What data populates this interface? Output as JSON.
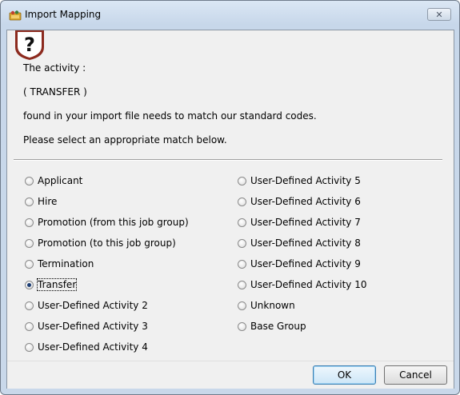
{
  "window": {
    "title": "Import Mapping",
    "close_label": "✕",
    "app_icon": "folder-users-icon"
  },
  "dialog": {
    "icon": "question-icon",
    "message_line1": "The activity :",
    "activity_code": "( TRANSFER )",
    "message_line2": "found in your import file needs to match our standard codes.",
    "message_line3": "Please select an appropriate match below."
  },
  "options": {
    "left": [
      {
        "label": "Applicant",
        "checked": false
      },
      {
        "label": "Hire",
        "checked": false
      },
      {
        "label": "Promotion (from this job group)",
        "checked": false
      },
      {
        "label": "Promotion (to this job group)",
        "checked": false
      },
      {
        "label": "Termination",
        "checked": false
      },
      {
        "label": "Transfer",
        "checked": true
      },
      {
        "label": "User-Defined Activity 2",
        "checked": false
      },
      {
        "label": "User-Defined Activity 3",
        "checked": false
      },
      {
        "label": "User-Defined Activity 4",
        "checked": false
      }
    ],
    "right": [
      {
        "label": "User-Defined Activity 5",
        "checked": false
      },
      {
        "label": "User-Defined Activity 6",
        "checked": false
      },
      {
        "label": "User-Defined Activity 7",
        "checked": false
      },
      {
        "label": "User-Defined Activity 8",
        "checked": false
      },
      {
        "label": "User-Defined Activity 9",
        "checked": false
      },
      {
        "label": "User-Defined Activity 10",
        "checked": false
      },
      {
        "label": "Unknown",
        "checked": false
      },
      {
        "label": "Base Group",
        "checked": false
      }
    ]
  },
  "buttons": {
    "ok_label": "OK",
    "cancel_label": "Cancel"
  }
}
